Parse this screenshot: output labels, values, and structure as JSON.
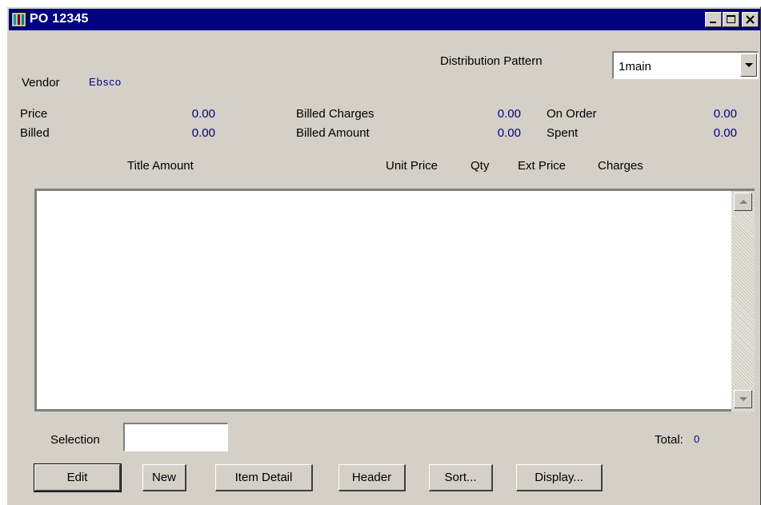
{
  "window": {
    "title": "PO 12345",
    "title_bar_color": "#000080",
    "controls": [
      "minimize-icon",
      "maximize-icon",
      "close-icon"
    ]
  },
  "header": {
    "vendor_label": "Vendor",
    "vendor_value": "Ebsco",
    "distribution_label": "Distribution Pattern",
    "distribution_value": "1main"
  },
  "summary": {
    "price_label": "Price",
    "price_value": "0.00",
    "billed_label": "Billed",
    "billed_value": "0.00",
    "billed_charges_label": "Billed Charges",
    "billed_charges_value": "0.00",
    "billed_amount_label": "Billed Amount",
    "billed_amount_value": "0.00",
    "on_order_label": "On Order",
    "on_order_value": "0.00",
    "spent_label": "Spent",
    "spent_value": "0.00"
  },
  "table": {
    "columns": [
      "Title Amount",
      "Unit Price",
      "Qty",
      "Ext Price",
      "Charges"
    ],
    "rows": []
  },
  "footer": {
    "selection_label": "Selection",
    "selection_value": "",
    "total_label": "Total:",
    "total_value": "0"
  },
  "buttons": {
    "edit": "Edit",
    "new": "New",
    "item_detail": "Item Detail",
    "header": "Header",
    "sort": "Sort...",
    "display": "Display..."
  },
  "colors": {
    "value_text": "#000080",
    "face": "#d4d0c8"
  }
}
